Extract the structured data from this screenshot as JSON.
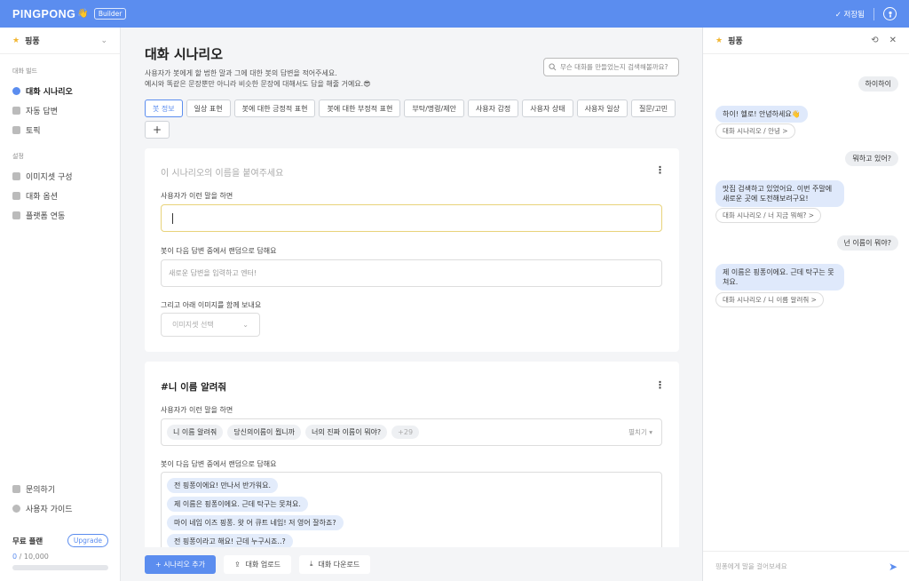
{
  "topbar": {
    "logo": "PINGPONG",
    "logo_emoji": "👋",
    "badge": "Builder",
    "save_status": "✓ 저장됨"
  },
  "sidebar": {
    "bot_name": "핑퐁",
    "section_dialog": "대화 빌드",
    "items_dialog": [
      "대화 시나리오",
      "자동 답변",
      "토픽"
    ],
    "section_settings": "설정",
    "items_settings": [
      "이미지셋 구성",
      "대화 옵션",
      "플랫폼 연동"
    ],
    "help": [
      "문의하기",
      "사용자 가이드"
    ],
    "plan": {
      "name": "무료 플랜",
      "upgrade": "Upgrade",
      "used": "0",
      "limit": "/ 10,000",
      "usage_fraction": 0.0
    }
  },
  "main": {
    "title": "대화 시나리오",
    "desc1": "사용자가 봇에게 할 법한 말과 그에 대한 봇의 답변을 적어주세요.",
    "desc2": "예시와 똑같은 문장뿐만 아니라 비슷한 문장에 대해서도 답을 해줄 거예요.😎",
    "search_placeholder": "무슨 대화를 만들었는지 검색해볼까요?",
    "tabs": [
      "봇 정보",
      "일상 표현",
      "봇에 대한 긍정적 표현",
      "봇에 대한 부정적 표현",
      "부탁/명령/제안",
      "사용자 감정",
      "사용자 상태",
      "사용자 일상",
      "질문/고민"
    ],
    "add_tab": "+",
    "card1": {
      "title_placeholder": "이 시나리오의 이름을 붙여주세요",
      "user_label": "사용자가 이런 말을 하면",
      "bot_label": "봇이 다음 답변 중에서 랜덤으로 답해요",
      "answer_placeholder": "새로운 답변을 입력하고 엔터!",
      "image_label": "그리고 아래 이미지를 함께 보내요",
      "image_select": "이미지셋 선택"
    },
    "card2": {
      "title": "#니 이름 알려줘",
      "user_label": "사용자가 이런 말을 하면",
      "chips": [
        "니 이름 알려줘",
        "당신의이름이 뭡니까",
        "너의 진짜 이름이 뭐야?"
      ],
      "more": "+29",
      "expand": "펼치기 ▾",
      "bot_label": "봇이 다음 답변 중에서 랜덤으로 답해요",
      "answers": [
        "전 핑퐁이에요! 만나서 반가워요.",
        "제 이름은 핑퐁이에요. 근데 탁구는 못쳐요.",
        "마이 네임 이즈 핑퐁. 왓 어 큐트 네임! 저 영어 잘하죠?",
        "전 핑퐁이라고 해요! 근데 누구시죠..?"
      ]
    },
    "footer": {
      "add": "+ 시나리오 추가",
      "upload": "대화 업로드",
      "download": "대화 다운로드"
    }
  },
  "chat": {
    "title": "핑퐁",
    "messages": {
      "u1": "하이하이",
      "b1": "하이! 헬로! 안녕하세요👋",
      "p1": "대화 시나리오 / 안녕 >",
      "u2": "뭐하고 있어?",
      "b2": "맛집 검색하고 있었어요. 이번 주말에 새로운 곳에 도전해보려구요!",
      "p2": "대화 시나리오 / 너 지금 뭐해? >",
      "u3": "넌 이름이 뭐야?",
      "b3": "제 이름은 핑퐁이에요. 근데 탁구는 못쳐요.",
      "p3": "대화 시나리오 / 니 이름 알려줘 >"
    },
    "input_placeholder": "핑퐁에게 말을 걸어보세요"
  },
  "colors": {
    "accent": "#5b8def",
    "focus_border": "#e8d37a"
  }
}
